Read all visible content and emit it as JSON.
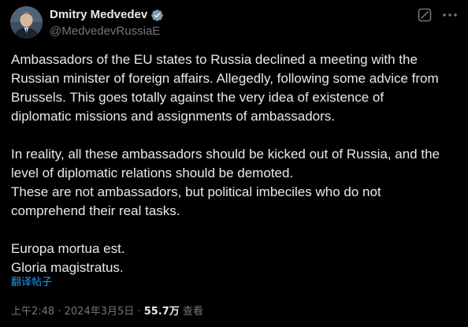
{
  "author": {
    "display_name": "Dmitry Medvedev",
    "handle": "@MedvedevRussiaE",
    "verified": true
  },
  "post": {
    "paragraphs": [
      {
        "lines": [
          "Ambassadors of the EU states to Russia declined a meeting with the",
          "Russian minister of foreign affairs. Allegedly, following some advice from",
          "Brussels. This goes totally against the very idea of existence of",
          "diplomatic missions and assignments of ambassadors."
        ]
      },
      {
        "lines": [
          "In reality, all these ambassadors should be kicked out of Russia, and the",
          "level of diplomatic relations should be demoted.",
          "These are not ambassadors, but political imbeciles who do not",
          "comprehend their real tasks."
        ]
      },
      {
        "lines": [
          "Europa mortua est.",
          "Gloria magistratus."
        ]
      }
    ],
    "translate_label": "翻译帖子"
  },
  "meta": {
    "time": "上午2:48",
    "separator": "·",
    "date": "2024年3月5日",
    "views_count": "55.7万",
    "views_label": "查看"
  },
  "icons": {
    "verified": "verified-badge-icon",
    "grok": "grok-icon",
    "more": "more-options-icon"
  },
  "colors": {
    "background": "#000000",
    "text": "#e7e9ea",
    "secondary": "#71767b",
    "accent": "#1d9bf0"
  }
}
